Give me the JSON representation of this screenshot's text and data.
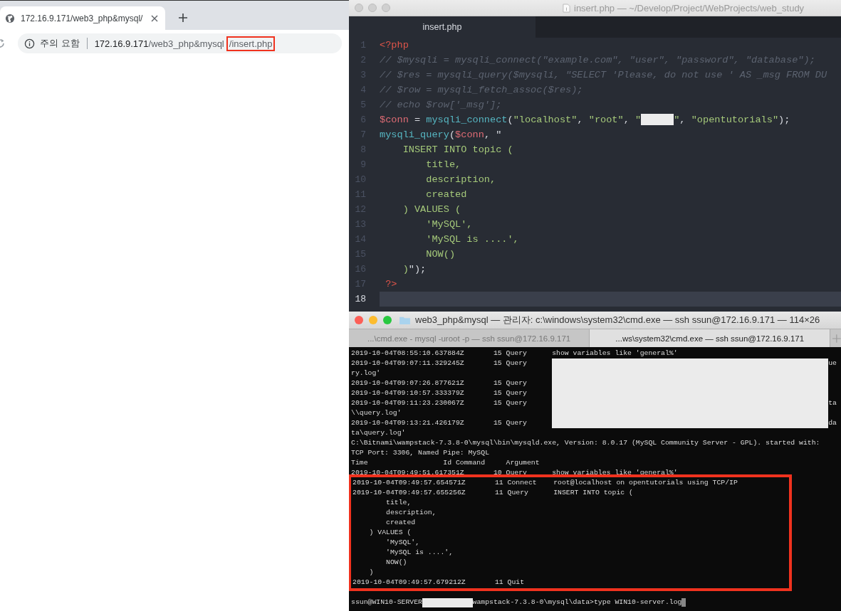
{
  "browser": {
    "tabs": [
      {
        "title": "172.16.9.171/web3_php&mysql/",
        "selected": true
      }
    ],
    "address": {
      "security": "주의 요함",
      "url": [
        {
          "text": "172.16.9.171",
          "kind": "host",
          "highlighted": false
        },
        {
          "text": "/web3_php&mysql",
          "kind": "path",
          "highlighted": false
        },
        {
          "text": "/insert.php",
          "kind": "path",
          "highlighted": true
        }
      ]
    }
  },
  "editor": {
    "title": "insert.php — ~/Develop/Project/WebProjects/web_study",
    "tabs": [
      {
        "label": "insert.php",
        "selected": true
      }
    ],
    "lines": [
      {
        "number": "1",
        "current": false,
        "tokens": [
          {
            "t": "<?php",
            "kind": "tag"
          }
        ]
      },
      {
        "number": "2",
        "current": false,
        "tokens": [
          {
            "t": "// $mysqli = mysqli_connect(\"example.com\", \"user\", \"password\", \"database\");",
            "kind": "comment"
          }
        ]
      },
      {
        "number": "3",
        "current": false,
        "tokens": [
          {
            "t": "// $res = mysqli_query($mysqli, \"SELECT 'Please, do not use ' AS _msg FROM DU",
            "kind": "comment"
          }
        ]
      },
      {
        "number": "4",
        "current": false,
        "tokens": [
          {
            "t": "// $row = mysqli_fetch_assoc($res);",
            "kind": "comment"
          }
        ]
      },
      {
        "number": "5",
        "current": false,
        "tokens": [
          {
            "t": "// echo $row['_msg'];",
            "kind": "comment"
          }
        ]
      },
      {
        "number": "6",
        "current": false,
        "tokens": [
          {
            "t": "$conn",
            "kind": "var"
          },
          {
            "t": " = ",
            "kind": "plain"
          },
          {
            "t": "mysqli_connect",
            "kind": "func"
          },
          {
            "t": "(",
            "kind": "plain"
          },
          {
            "t": "\"localhost\"",
            "kind": "string"
          },
          {
            "t": ", ",
            "kind": "plain"
          },
          {
            "t": "\"root\"",
            "kind": "string"
          },
          {
            "t": ", ",
            "kind": "plain"
          },
          {
            "t": "\"",
            "kind": "string"
          },
          {
            "kind": "redacted"
          },
          {
            "t": "\"",
            "kind": "string"
          },
          {
            "t": ", ",
            "kind": "plain"
          },
          {
            "t": "\"opentutorials\"",
            "kind": "string"
          },
          {
            "t": ");",
            "kind": "plain"
          }
        ]
      },
      {
        "number": "7",
        "current": false,
        "tokens": [
          {
            "t": "mysqli_query",
            "kind": "func"
          },
          {
            "t": "(",
            "kind": "plain"
          },
          {
            "t": "$conn",
            "kind": "var"
          },
          {
            "t": ", \"",
            "kind": "plain"
          }
        ]
      },
      {
        "number": "8",
        "current": false,
        "tokens": [
          {
            "t": "    INSERT INTO topic (",
            "kind": "string"
          }
        ]
      },
      {
        "number": "9",
        "current": false,
        "tokens": [
          {
            "t": "        title,",
            "kind": "string"
          }
        ]
      },
      {
        "number": "10",
        "current": false,
        "tokens": [
          {
            "t": "        description,",
            "kind": "string"
          }
        ]
      },
      {
        "number": "11",
        "current": false,
        "tokens": [
          {
            "t": "        created",
            "kind": "string"
          }
        ]
      },
      {
        "number": "12",
        "current": false,
        "tokens": [
          {
            "t": "    ) VALUES (",
            "kind": "string"
          }
        ]
      },
      {
        "number": "13",
        "current": false,
        "tokens": [
          {
            "t": "        'MySQL',",
            "kind": "string"
          }
        ]
      },
      {
        "number": "14",
        "current": false,
        "tokens": [
          {
            "t": "        'MySQL is ....',",
            "kind": "string"
          }
        ]
      },
      {
        "number": "15",
        "current": false,
        "tokens": [
          {
            "t": "        NOW()",
            "kind": "string"
          }
        ]
      },
      {
        "number": "16",
        "current": false,
        "tokens": [
          {
            "t": "    )",
            "kind": "string"
          },
          {
            "t": "\");",
            "kind": "plain"
          }
        ]
      },
      {
        "number": "17",
        "current": false,
        "tokens": [
          {
            "t": " ?>",
            "kind": "tag"
          }
        ]
      },
      {
        "number": "18",
        "current": true
      }
    ]
  },
  "terminal": {
    "title": "web3_php&mysql — 관리자: c:\\windows\\system32\\cmd.exe — ssh ssun@172.16.9.171 — 114×26",
    "tabs": [
      {
        "label": "...\\cmd.exe - mysql  -uroot -p — ssh ssun@172.16.9.171",
        "selected": false
      },
      {
        "label": "...ws\\system32\\cmd.exe — ssh ssun@172.16.9.171",
        "selected": true
      }
    ],
    "sections": [
      {
        "highlighted": false,
        "lines": [
          {
            "text": "2019-10-04T08:55:10.637884Z       15 Query      show variables like 'general%'",
            "redacted": false
          },
          {
            "text": "2019-10-04T09:07:11.329245Z       15 Query",
            "redacted": true,
            "tail": "ue"
          },
          {
            "text": "ry.log'",
            "redacted": true
          },
          {
            "text": "2019-10-04T09:07:26.877621Z       15 Query",
            "redacted": true
          },
          {
            "text": "2019-10-04T09:10:57.333379Z       15 Query",
            "redacted": true
          },
          {
            "text": "2019-10-04T09:11:23.230067Z       15 Query",
            "redacted": true,
            "tail": "ta"
          },
          {
            "text": "\\\\query.log'",
            "redacted": true
          },
          {
            "text": "2019-10-04T09:13:21.426179Z       15 Query",
            "redacted": true,
            "tail": "da"
          },
          {
            "text": "ta\\query.log'",
            "redacted": false
          },
          {
            "text": "C:\\Bitnami\\wampstack-7.3.8-0\\mysql\\bin\\mysqld.exe, Version: 8.0.17 (MySQL Community Server - GPL). started with:",
            "redacted": false
          },
          {
            "text": "TCP Port: 3306, Named Pipe: MySQL",
            "redacted": false
          },
          {
            "text": "Time                  Id Command     Argument",
            "redacted": false
          },
          {
            "text": "2019-10-04T09:49:51.617351Z       10 Query      show variables like 'general%'",
            "redacted": false
          }
        ]
      },
      {
        "highlighted": true,
        "lines": [
          {
            "text": "2019-10-04T09:49:57.654571Z       11 Connect    root@localhost on opentutorials using TCP/IP",
            "redacted": false
          },
          {
            "text": "2019-10-04T09:49:57.655256Z       11 Query      INSERT INTO topic (",
            "redacted": false
          },
          {
            "text": "        title,",
            "redacted": false
          },
          {
            "text": "        description,",
            "redacted": false
          },
          {
            "text": "        created",
            "redacted": false
          },
          {
            "text": "    ) VALUES (",
            "redacted": false
          },
          {
            "text": "        'MySQL',",
            "redacted": false
          },
          {
            "text": "        'MySQL is ....',",
            "redacted": false
          },
          {
            "text": "        NOW()",
            "redacted": false
          },
          {
            "text": "    )",
            "redacted": false
          },
          {
            "text": "2019-10-04T09:49:57.679212Z       11 Quit",
            "redacted": false
          }
        ]
      }
    ],
    "prompt": {
      "user_host": "ssun@WIN10-SERVER",
      "redacted": true,
      "rest": "wampstack-7.3.8-0\\mysql\\data>type WIN10-server.log"
    }
  }
}
